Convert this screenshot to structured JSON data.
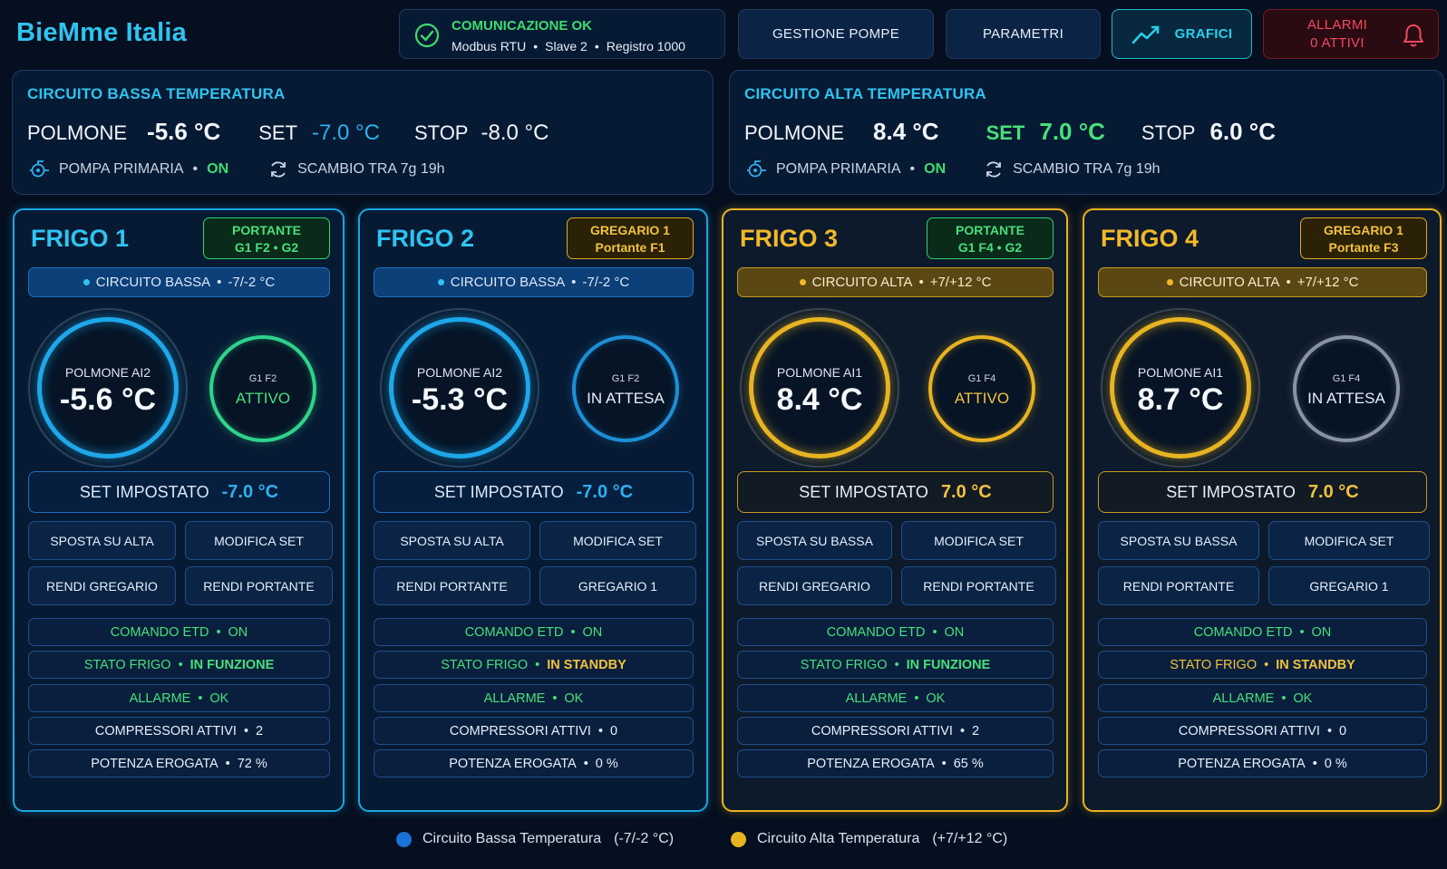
{
  "brand": "BieMme Italia",
  "comm": {
    "title": "COMUNICAZIONE OK",
    "protocol": "Modbus RTU",
    "slave": "Slave 2",
    "register": "Registro 1000",
    "sep": "•"
  },
  "nav": {
    "pompe": "GESTIONE POMPE",
    "parametri": "PARAMETRI",
    "grafici": "GRAFICI",
    "allarmi_line1": "ALLARMI",
    "allarmi_line2": "0 ATTIVI"
  },
  "colors": {
    "low": "#1aa6e0",
    "high": "#e8b321",
    "ok_green": "#3ddc6e",
    "alarm_red": "#f04a5e"
  },
  "circuits": {
    "low": {
      "title": "CIRCUITO BASSA TEMPERATURA",
      "polmone_label": "POLMONE",
      "polmone_value": "-5.6 °C",
      "set_label": "SET",
      "set_value": "-7.0 °C",
      "stop_label": "STOP",
      "stop_value": "-8.0 °C",
      "pump_label": "POMPA PRIMARIA",
      "pump_state": "ON",
      "exchange": "SCAMBIO TRA 7g 19h"
    },
    "high": {
      "title": "CIRCUITO ALTA TEMPERATURA",
      "polmone_label": "POLMONE",
      "polmone_value": "8.4 °C",
      "set_label": "SET",
      "set_value": "7.0 °C",
      "stop_label": "STOP",
      "stop_value": "6.0 °C",
      "pump_label": "POMPA PRIMARIA",
      "pump_state": "ON",
      "exchange": "SCAMBIO TRA 7g 19h"
    }
  },
  "frighi": [
    {
      "title": "FRIGO 1",
      "role_line1": "PORTANTE",
      "role_line2": "G1 F2  •  G2",
      "circuit": "CIRCUITO BASSA",
      "range": "-7/-2 °C",
      "gauge_label": "POLMONE  AI2",
      "gauge_value": "-5.6 °C",
      "small_label": "G1 F2",
      "small_state": "ATTIVO",
      "set_label": "SET IMPOSTATO",
      "set_value": "-7.0 °C",
      "btn1": "SPOSTA SU ALTA",
      "btn2": "MODIFICA SET",
      "btn3": "RENDI GREGARIO",
      "btn4": "RENDI PORTANTE",
      "etd_label": "COMANDO ETD",
      "etd_value": "ON",
      "stato_label": "STATO FRIGO",
      "stato_value": "IN FUNZIONE",
      "allarme_label": "ALLARME",
      "allarme_value": "OK",
      "comp_label": "COMPRESSORI ATTIVI",
      "comp_value": "2",
      "pot_label": "POTENZA EROGATA",
      "pot_value": "72 %"
    },
    {
      "title": "FRIGO 2",
      "role_line1": "GREGARIO 1",
      "role_line2": "Portante F1",
      "circuit": "CIRCUITO BASSA",
      "range": "-7/-2 °C",
      "gauge_label": "POLMONE  AI2",
      "gauge_value": "-5.3 °C",
      "small_label": "G1 F2",
      "small_state": "IN ATTESA",
      "set_label": "SET IMPOSTATO",
      "set_value": "-7.0 °C",
      "btn1": "SPOSTA SU ALTA",
      "btn2": "MODIFICA SET",
      "btn3": "RENDI PORTANTE",
      "btn4": "GREGARIO 1",
      "etd_label": "COMANDO ETD",
      "etd_value": "ON",
      "stato_label": "STATO FRIGO",
      "stato_value": "IN STANDBY",
      "allarme_label": "ALLARME",
      "allarme_value": "OK",
      "comp_label": "COMPRESSORI ATTIVI",
      "comp_value": "0",
      "pot_label": "POTENZA EROGATA",
      "pot_value": "0 %"
    },
    {
      "title": "FRIGO 3",
      "role_line1": "PORTANTE",
      "role_line2": "G1 F4  •  G2",
      "circuit": "CIRCUITO ALTA",
      "range": "+7/+12 °C",
      "gauge_label": "POLMONE  AI1",
      "gauge_value": "8.4 °C",
      "small_label": "G1 F4",
      "small_state": "ATTIVO",
      "set_label": "SET IMPOSTATO",
      "set_value": "7.0 °C",
      "btn1": "SPOSTA SU BASSA",
      "btn2": "MODIFICA SET",
      "btn3": "RENDI GREGARIO",
      "btn4": "RENDI PORTANTE",
      "etd_label": "COMANDO ETD",
      "etd_value": "ON",
      "stato_label": "STATO FRIGO",
      "stato_value": "IN FUNZIONE",
      "allarme_label": "ALLARME",
      "allarme_value": "OK",
      "comp_label": "COMPRESSORI ATTIVI",
      "comp_value": "2",
      "pot_label": "POTENZA EROGATA",
      "pot_value": "65 %"
    },
    {
      "title": "FRIGO 4",
      "role_line1": "GREGARIO 1",
      "role_line2": "Portante F3",
      "circuit": "CIRCUITO ALTA",
      "range": "+7/+12 °C",
      "gauge_label": "POLMONE  AI1",
      "gauge_value": "8.7 °C",
      "small_label": "G1 F4",
      "small_state": "IN ATTESA",
      "set_label": "SET IMPOSTATO",
      "set_value": "7.0 °C",
      "btn1": "SPOSTA SU BASSA",
      "btn2": "MODIFICA SET",
      "btn3": "RENDI PORTANTE",
      "btn4": "GREGARIO 1",
      "etd_label": "COMANDO ETD",
      "etd_value": "ON",
      "stato_label": "STATO FRIGO",
      "stato_value": "IN STANDBY",
      "allarme_label": "ALLARME",
      "allarme_value": "OK",
      "comp_label": "COMPRESSORI ATTIVI",
      "comp_value": "0",
      "pot_label": "POTENZA EROGATA",
      "pot_value": "0 %"
    }
  ],
  "legend": {
    "low": "Circuito Bassa Temperatura",
    "low_range": "(-7/-2 °C)",
    "high": "Circuito Alta Temperatura",
    "high_range": "(+7/+12 °C)"
  }
}
